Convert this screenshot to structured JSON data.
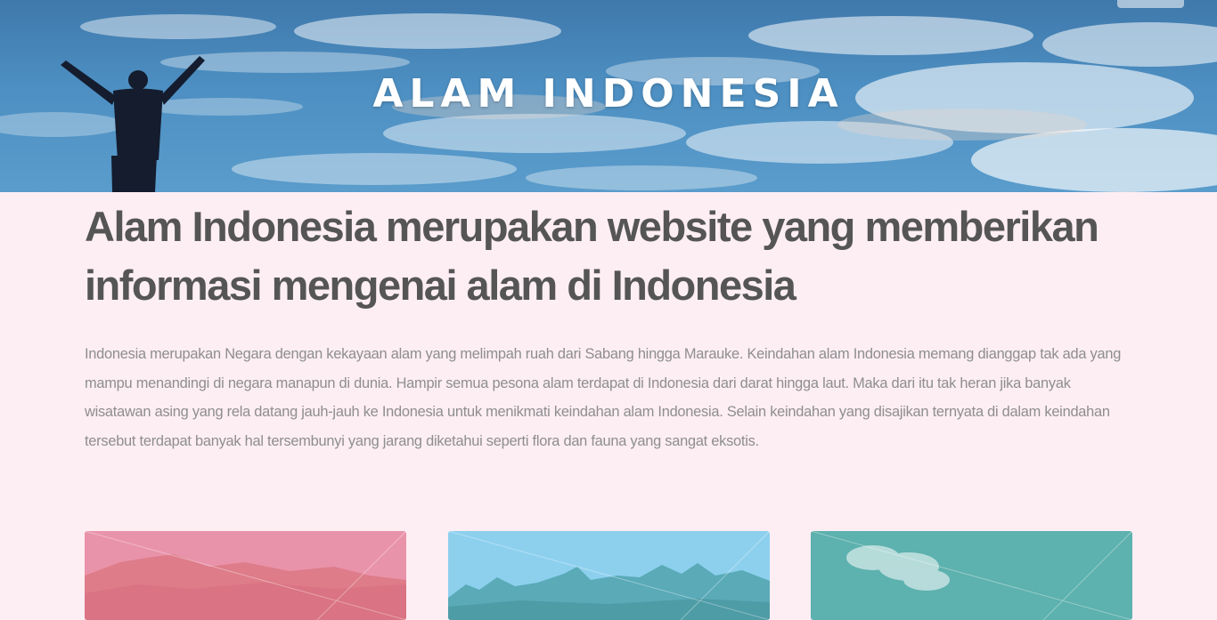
{
  "header": {
    "title": "ALAM INDONESIA",
    "background_icon": "person-raising-arms-sky-icon"
  },
  "main": {
    "headline": "Alam Indonesia merupakan website yang memberikan informasi mengenai alam di Indonesia",
    "description": "Indonesia merupakan Negara dengan kekayaan alam yang melimpah ruah dari Sabang hingga Marauke. Keindahan alam Indonesia memang dianggap tak ada yang mampu menandingi di negara manapun di dunia. Hampir semua pesona alam terdapat di Indonesia dari darat hingga laut. Maka dari itu tak heran jika banyak wisatawan asing yang rela datang jauh-jauh ke Indonesia untuk menikmati keindahan alam Indonesia. Selain keindahan yang disajikan ternyata di dalam keindahan tersebut terdapat banyak hal tersembunyi yang jarang diketahui seperti flora dan fauna yang sangat eksotis."
  },
  "cards": [
    {
      "name": "mountain-card",
      "overlay_color": "#e98ea6"
    },
    {
      "name": "karst-hills-card",
      "overlay_color": "#86cdea"
    },
    {
      "name": "teal-sky-card",
      "overlay_color": "#5fb3b0"
    }
  ],
  "colors": {
    "page_background": "#fdeef4",
    "headline_text": "#555555",
    "body_text": "#8e8e8e",
    "hero_text": "#ffffff"
  }
}
